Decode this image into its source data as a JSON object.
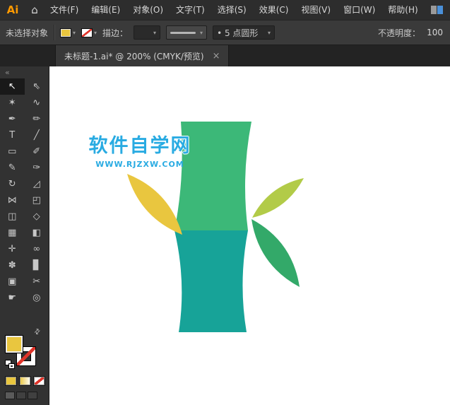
{
  "menubar": {
    "logo": "Ai",
    "home_glyph": "⌂",
    "items": [
      "文件(F)",
      "编辑(E)",
      "对象(O)",
      "文字(T)",
      "选择(S)",
      "效果(C)",
      "视图(V)",
      "窗口(W)",
      "帮助(H)"
    ]
  },
  "controlbar": {
    "no_selection": "未选择对象",
    "stroke_label": "描边：",
    "stroke_weight_value": "",
    "brush_value": "• 5 点圆形",
    "opacity_label": "不透明度：",
    "opacity_value": "100"
  },
  "tabbar": {
    "tab_label": "未标题-1.ai* @ 200% (CMYK/预览)"
  },
  "toolbar": {
    "collapse_glyph": "«",
    "tools": [
      {
        "name": "selection",
        "glyph": "↖",
        "selected": true
      },
      {
        "name": "direct-selection",
        "glyph": "⇖"
      },
      {
        "name": "magic-wand",
        "glyph": "✶"
      },
      {
        "name": "lasso",
        "glyph": "∿"
      },
      {
        "name": "pen",
        "glyph": "✒"
      },
      {
        "name": "curvature",
        "glyph": "✏"
      },
      {
        "name": "type",
        "glyph": "T"
      },
      {
        "name": "line-segment",
        "glyph": "╱"
      },
      {
        "name": "rectangle",
        "glyph": "▭"
      },
      {
        "name": "paintbrush",
        "glyph": "✐"
      },
      {
        "name": "shaper",
        "glyph": "✎"
      },
      {
        "name": "pencil",
        "glyph": "✑"
      },
      {
        "name": "rotate",
        "glyph": "↻"
      },
      {
        "name": "scale",
        "glyph": "◿"
      },
      {
        "name": "width",
        "glyph": "⋈"
      },
      {
        "name": "free-transform",
        "glyph": "◰"
      },
      {
        "name": "shape-builder",
        "glyph": "◫"
      },
      {
        "name": "perspective-grid",
        "glyph": "◇"
      },
      {
        "name": "mesh",
        "glyph": "▦"
      },
      {
        "name": "gradient",
        "glyph": "◧"
      },
      {
        "name": "eyedropper",
        "glyph": "✛"
      },
      {
        "name": "blend",
        "glyph": "∞"
      },
      {
        "name": "symbol-sprayer",
        "glyph": "✽"
      },
      {
        "name": "column-graph",
        "glyph": "▊"
      },
      {
        "name": "artboard",
        "glyph": "▣"
      },
      {
        "name": "slice",
        "glyph": "✂"
      },
      {
        "name": "hand",
        "glyph": "☛"
      },
      {
        "name": "zoom",
        "glyph": "◎"
      }
    ]
  },
  "glyphs": {
    "chevron": "▾",
    "close": "×",
    "swap": "⇄"
  },
  "canvas": {
    "watermark_title": "软件自学网",
    "watermark_url": "WWW.RJZXW.COM"
  },
  "artwork": {
    "colors": {
      "trunk_top": "#3CB878",
      "trunk_bottom": "#17A398",
      "leaf_left": "#E9C63F",
      "leaf_right_top": "#B2CB48",
      "leaf_right_bottom": "#33A969",
      "watermark": "#29ABE2",
      "fill": "#E9C63F"
    }
  }
}
